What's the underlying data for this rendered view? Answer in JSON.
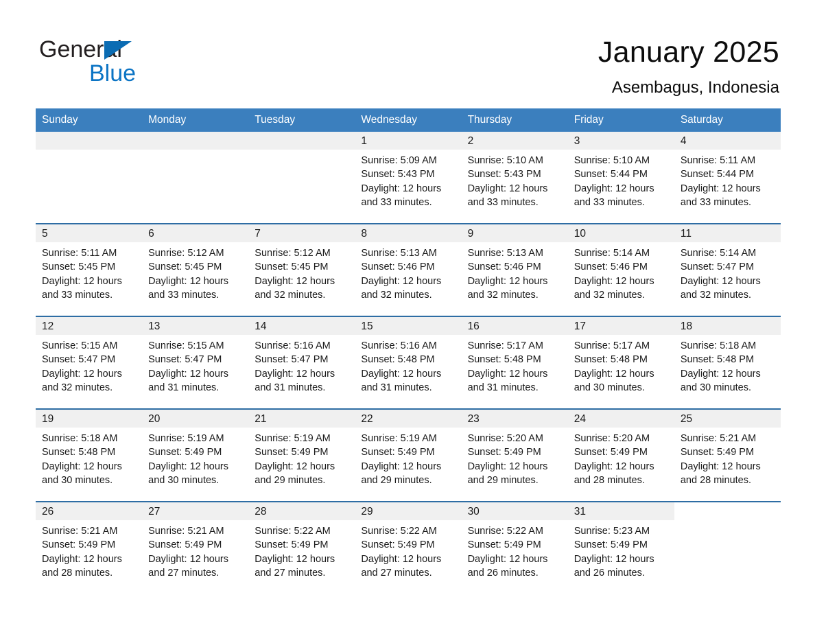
{
  "brand": {
    "name_part1": "General",
    "name_part2": "Blue",
    "logo_icon": "triangle-logo-icon",
    "accent_color": "#0b74c4"
  },
  "header": {
    "title": "January 2025",
    "location": "Asembagus, Indonesia"
  },
  "theme": {
    "header_row_bg": "#3b7fbe",
    "row_divider": "#2e6da4",
    "daynum_bg": "#f0f0f0",
    "text": "#1a1a1a"
  },
  "weekdays": [
    "Sunday",
    "Monday",
    "Tuesday",
    "Wednesday",
    "Thursday",
    "Friday",
    "Saturday"
  ],
  "labels": {
    "sunrise_prefix": "Sunrise:",
    "sunset_prefix": "Sunset:",
    "daylight_prefix": "Daylight:"
  },
  "weeks": [
    [
      {
        "day": "",
        "sunrise": "",
        "sunset": "",
        "daylight_line1": "",
        "daylight_line2": ""
      },
      {
        "day": "",
        "sunrise": "",
        "sunset": "",
        "daylight_line1": "",
        "daylight_line2": ""
      },
      {
        "day": "",
        "sunrise": "",
        "sunset": "",
        "daylight_line1": "",
        "daylight_line2": ""
      },
      {
        "day": "1",
        "sunrise": "Sunrise: 5:09 AM",
        "sunset": "Sunset: 5:43 PM",
        "daylight_line1": "Daylight: 12 hours",
        "daylight_line2": "and 33 minutes."
      },
      {
        "day": "2",
        "sunrise": "Sunrise: 5:10 AM",
        "sunset": "Sunset: 5:43 PM",
        "daylight_line1": "Daylight: 12 hours",
        "daylight_line2": "and 33 minutes."
      },
      {
        "day": "3",
        "sunrise": "Sunrise: 5:10 AM",
        "sunset": "Sunset: 5:44 PM",
        "daylight_line1": "Daylight: 12 hours",
        "daylight_line2": "and 33 minutes."
      },
      {
        "day": "4",
        "sunrise": "Sunrise: 5:11 AM",
        "sunset": "Sunset: 5:44 PM",
        "daylight_line1": "Daylight: 12 hours",
        "daylight_line2": "and 33 minutes."
      }
    ],
    [
      {
        "day": "5",
        "sunrise": "Sunrise: 5:11 AM",
        "sunset": "Sunset: 5:45 PM",
        "daylight_line1": "Daylight: 12 hours",
        "daylight_line2": "and 33 minutes."
      },
      {
        "day": "6",
        "sunrise": "Sunrise: 5:12 AM",
        "sunset": "Sunset: 5:45 PM",
        "daylight_line1": "Daylight: 12 hours",
        "daylight_line2": "and 33 minutes."
      },
      {
        "day": "7",
        "sunrise": "Sunrise: 5:12 AM",
        "sunset": "Sunset: 5:45 PM",
        "daylight_line1": "Daylight: 12 hours",
        "daylight_line2": "and 32 minutes."
      },
      {
        "day": "8",
        "sunrise": "Sunrise: 5:13 AM",
        "sunset": "Sunset: 5:46 PM",
        "daylight_line1": "Daylight: 12 hours",
        "daylight_line2": "and 32 minutes."
      },
      {
        "day": "9",
        "sunrise": "Sunrise: 5:13 AM",
        "sunset": "Sunset: 5:46 PM",
        "daylight_line1": "Daylight: 12 hours",
        "daylight_line2": "and 32 minutes."
      },
      {
        "day": "10",
        "sunrise": "Sunrise: 5:14 AM",
        "sunset": "Sunset: 5:46 PM",
        "daylight_line1": "Daylight: 12 hours",
        "daylight_line2": "and 32 minutes."
      },
      {
        "day": "11",
        "sunrise": "Sunrise: 5:14 AM",
        "sunset": "Sunset: 5:47 PM",
        "daylight_line1": "Daylight: 12 hours",
        "daylight_line2": "and 32 minutes."
      }
    ],
    [
      {
        "day": "12",
        "sunrise": "Sunrise: 5:15 AM",
        "sunset": "Sunset: 5:47 PM",
        "daylight_line1": "Daylight: 12 hours",
        "daylight_line2": "and 32 minutes."
      },
      {
        "day": "13",
        "sunrise": "Sunrise: 5:15 AM",
        "sunset": "Sunset: 5:47 PM",
        "daylight_line1": "Daylight: 12 hours",
        "daylight_line2": "and 31 minutes."
      },
      {
        "day": "14",
        "sunrise": "Sunrise: 5:16 AM",
        "sunset": "Sunset: 5:47 PM",
        "daylight_line1": "Daylight: 12 hours",
        "daylight_line2": "and 31 minutes."
      },
      {
        "day": "15",
        "sunrise": "Sunrise: 5:16 AM",
        "sunset": "Sunset: 5:48 PM",
        "daylight_line1": "Daylight: 12 hours",
        "daylight_line2": "and 31 minutes."
      },
      {
        "day": "16",
        "sunrise": "Sunrise: 5:17 AM",
        "sunset": "Sunset: 5:48 PM",
        "daylight_line1": "Daylight: 12 hours",
        "daylight_line2": "and 31 minutes."
      },
      {
        "day": "17",
        "sunrise": "Sunrise: 5:17 AM",
        "sunset": "Sunset: 5:48 PM",
        "daylight_line1": "Daylight: 12 hours",
        "daylight_line2": "and 30 minutes."
      },
      {
        "day": "18",
        "sunrise": "Sunrise: 5:18 AM",
        "sunset": "Sunset: 5:48 PM",
        "daylight_line1": "Daylight: 12 hours",
        "daylight_line2": "and 30 minutes."
      }
    ],
    [
      {
        "day": "19",
        "sunrise": "Sunrise: 5:18 AM",
        "sunset": "Sunset: 5:48 PM",
        "daylight_line1": "Daylight: 12 hours",
        "daylight_line2": "and 30 minutes."
      },
      {
        "day": "20",
        "sunrise": "Sunrise: 5:19 AM",
        "sunset": "Sunset: 5:49 PM",
        "daylight_line1": "Daylight: 12 hours",
        "daylight_line2": "and 30 minutes."
      },
      {
        "day": "21",
        "sunrise": "Sunrise: 5:19 AM",
        "sunset": "Sunset: 5:49 PM",
        "daylight_line1": "Daylight: 12 hours",
        "daylight_line2": "and 29 minutes."
      },
      {
        "day": "22",
        "sunrise": "Sunrise: 5:19 AM",
        "sunset": "Sunset: 5:49 PM",
        "daylight_line1": "Daylight: 12 hours",
        "daylight_line2": "and 29 minutes."
      },
      {
        "day": "23",
        "sunrise": "Sunrise: 5:20 AM",
        "sunset": "Sunset: 5:49 PM",
        "daylight_line1": "Daylight: 12 hours",
        "daylight_line2": "and 29 minutes."
      },
      {
        "day": "24",
        "sunrise": "Sunrise: 5:20 AM",
        "sunset": "Sunset: 5:49 PM",
        "daylight_line1": "Daylight: 12 hours",
        "daylight_line2": "and 28 minutes."
      },
      {
        "day": "25",
        "sunrise": "Sunrise: 5:21 AM",
        "sunset": "Sunset: 5:49 PM",
        "daylight_line1": "Daylight: 12 hours",
        "daylight_line2": "and 28 minutes."
      }
    ],
    [
      {
        "day": "26",
        "sunrise": "Sunrise: 5:21 AM",
        "sunset": "Sunset: 5:49 PM",
        "daylight_line1": "Daylight: 12 hours",
        "daylight_line2": "and 28 minutes."
      },
      {
        "day": "27",
        "sunrise": "Sunrise: 5:21 AM",
        "sunset": "Sunset: 5:49 PM",
        "daylight_line1": "Daylight: 12 hours",
        "daylight_line2": "and 27 minutes."
      },
      {
        "day": "28",
        "sunrise": "Sunrise: 5:22 AM",
        "sunset": "Sunset: 5:49 PM",
        "daylight_line1": "Daylight: 12 hours",
        "daylight_line2": "and 27 minutes."
      },
      {
        "day": "29",
        "sunrise": "Sunrise: 5:22 AM",
        "sunset": "Sunset: 5:49 PM",
        "daylight_line1": "Daylight: 12 hours",
        "daylight_line2": "and 27 minutes."
      },
      {
        "day": "30",
        "sunrise": "Sunrise: 5:22 AM",
        "sunset": "Sunset: 5:49 PM",
        "daylight_line1": "Daylight: 12 hours",
        "daylight_line2": "and 26 minutes."
      },
      {
        "day": "31",
        "sunrise": "Sunrise: 5:23 AM",
        "sunset": "Sunset: 5:49 PM",
        "daylight_line1": "Daylight: 12 hours",
        "daylight_line2": "and 26 minutes."
      },
      {
        "day": "",
        "sunrise": "",
        "sunset": "",
        "daylight_line1": "",
        "daylight_line2": ""
      }
    ]
  ]
}
